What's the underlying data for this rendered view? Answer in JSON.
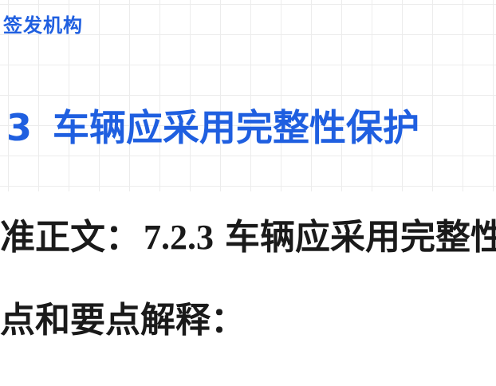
{
  "header": {
    "org_label": "签发机构"
  },
  "section": {
    "number": "3",
    "title": "车辆应采用完整性保护"
  },
  "content": {
    "standard_prefix": "准正文：",
    "clause_number": "7.2.3",
    "clause_text": "车辆应采用完整性保护",
    "notes_heading": "点和要点解释："
  }
}
